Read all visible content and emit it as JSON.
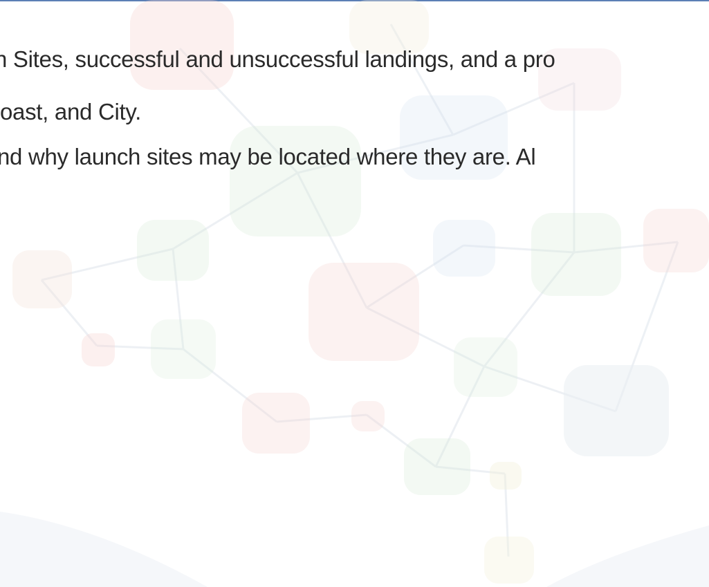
{
  "body_text": {
    "line_1": "n Sites, successful and unsuccessful landings, and a pro",
    "line_2": "oast, and City.",
    "line_3": "nd why launch sites may be located where they are. Al"
  },
  "colors": {
    "top_rule": "#5b7fb5",
    "text": "#2a2a2a",
    "network_red": "#f6d3d0",
    "network_green": "#d8ecd6",
    "network_blue": "#d7e6f3",
    "network_gray": "#e9eef3",
    "network_yellow": "#f3f0da"
  }
}
